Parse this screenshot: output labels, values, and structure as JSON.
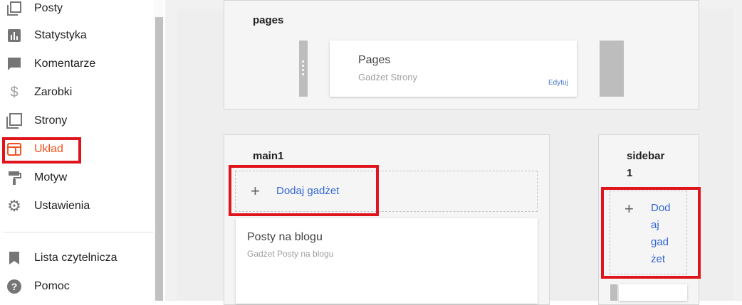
{
  "sidebar": {
    "items": [
      {
        "label": "Posty",
        "icon": "posts-icon"
      },
      {
        "label": "Statystyka",
        "icon": "stats-icon"
      },
      {
        "label": "Komentarze",
        "icon": "comments-icon"
      },
      {
        "label": "Zarobki",
        "icon": "dollar-icon"
      },
      {
        "label": "Strony",
        "icon": "pages-icon"
      },
      {
        "label": "Układ",
        "icon": "layout-icon"
      },
      {
        "label": "Motyw",
        "icon": "paint-roller-icon"
      },
      {
        "label": "Ustawienia",
        "icon": "gear-icon"
      },
      {
        "label": "Lista czytelnicza",
        "icon": "bookmark-icon"
      },
      {
        "label": "Pomoc",
        "icon": "help-icon"
      }
    ],
    "active_item": "Układ",
    "accent_color": "#f4511e"
  },
  "layout": {
    "pages_section": {
      "title": "pages",
      "gadget": {
        "title": "Pages",
        "subtitle": "Gadżet Strony",
        "edit_label": "Edytuj"
      }
    },
    "main_section": {
      "title": "main1",
      "add_gadget_label": "Dodaj gadżet",
      "gadget": {
        "title": "Posty na blogu",
        "subtitle": "Gadżet Posty na blogu"
      }
    },
    "sidebar_section": {
      "title_line1": "sidebar",
      "title_line2": "1",
      "add_gadget_lines": [
        "Dod",
        "aj",
        "gad",
        "żet"
      ]
    }
  },
  "highlight_color": "#e0141c"
}
